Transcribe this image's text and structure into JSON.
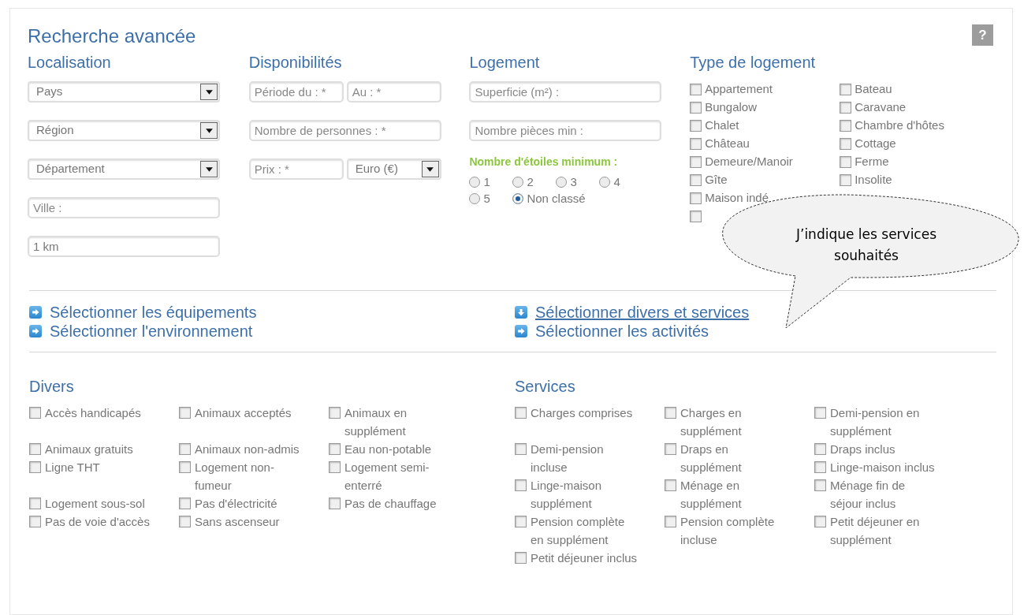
{
  "title": "Recherche avancée",
  "help": "?",
  "localisation": {
    "heading": "Localisation",
    "fields": [
      {
        "kind": "select",
        "value": "Pays"
      },
      {
        "kind": "select",
        "value": "Région"
      },
      {
        "kind": "select",
        "value": "Département"
      },
      {
        "kind": "input",
        "placeholder": "Ville :"
      },
      {
        "kind": "input",
        "value": "1 km"
      }
    ]
  },
  "disponibilites": {
    "heading": "Disponibilités",
    "rows": [
      [
        {
          "kind": "input",
          "placeholder": "Période du : *"
        },
        {
          "kind": "input",
          "placeholder": "Au : *"
        }
      ],
      [
        {
          "kind": "input",
          "placeholder": "Nombre de personnes : *"
        }
      ],
      [
        {
          "kind": "input",
          "placeholder": "Prix : *"
        },
        {
          "kind": "select",
          "value": "Euro (€)"
        }
      ]
    ]
  },
  "logement": {
    "heading": "Logement",
    "fields": [
      {
        "kind": "input",
        "placeholder": "Superficie (m²) :"
      },
      {
        "kind": "input",
        "placeholder": "Nombre pièces min :"
      }
    ],
    "stars_label": "Nombre d'étoiles minimum :",
    "stars_options": [
      {
        "label": "1",
        "selected": false
      },
      {
        "label": "2",
        "selected": false
      },
      {
        "label": "3",
        "selected": false
      },
      {
        "label": "4",
        "selected": false
      },
      {
        "label": "5",
        "selected": false
      },
      {
        "label": "Non classé",
        "selected": true
      }
    ]
  },
  "type_logement": {
    "heading": "Type de logement",
    "columns": [
      [
        {
          "label": "Appartement",
          "checked": false
        },
        {
          "label": "Bungalow",
          "checked": false
        },
        {
          "label": "Chalet",
          "checked": false
        },
        {
          "label": "Château",
          "checked": false
        },
        {
          "label": "Demeure/Manoir",
          "checked": false
        },
        {
          "label": "Gîte",
          "checked": false
        },
        {
          "label": "Maison indé",
          "checked": false
        },
        {
          "checked": false
        }
      ],
      [
        {
          "label": "Bateau",
          "checked": false
        },
        {
          "label": "Caravane",
          "checked": false
        },
        {
          "label": "Chambre d'hôtes",
          "checked": false
        },
        {
          "label": "Cottage",
          "checked": false
        },
        {
          "label": "Ferme",
          "checked": false
        },
        {
          "label": "Insolite",
          "checked": false
        }
      ]
    ]
  },
  "callout": "J’indique  les services souhaités",
  "links": [
    [
      {
        "label": "Sélectionner les équipements",
        "expanded": false
      },
      {
        "label": "Sélectionner l'environnement",
        "expanded": false
      }
    ],
    [
      {
        "label": "Sélectionner divers et services",
        "expanded": true
      },
      {
        "label": "Sélectionner les activités",
        "expanded": false
      }
    ]
  ],
  "divers": {
    "heading": "Divers",
    "items": [
      {
        "label": "Accès handicapés",
        "checked": false
      },
      {
        "label": "Animaux acceptés",
        "checked": false
      },
      {
        "label": "Animaux en supplément",
        "checked": false
      },
      {
        "label": "Animaux gratuits",
        "checked": false
      },
      {
        "label": "Animaux non-admis",
        "checked": false
      },
      {
        "label": "Eau non-potable",
        "checked": false
      },
      {
        "label": "Ligne THT",
        "checked": false
      },
      {
        "label": "Logement non-fumeur",
        "checked": false
      },
      {
        "label": "Logement semi-enterré",
        "checked": false
      },
      {
        "label": "Logement sous-sol",
        "checked": false
      },
      {
        "label": "Pas d'électricité",
        "checked": false
      },
      {
        "label": "Pas de chauffage",
        "checked": false
      },
      {
        "label": "Pas de voie d'accès",
        "checked": false
      },
      {
        "label": "Sans ascenseur",
        "checked": false
      }
    ]
  },
  "services": {
    "heading": "Services",
    "items": [
      {
        "label": "Charges comprises",
        "checked": false
      },
      {
        "label": "Charges en supplément",
        "checked": false
      },
      {
        "label": "Demi-pension en supplément",
        "checked": false
      },
      {
        "label": "Demi-pension incluse",
        "checked": false
      },
      {
        "label": "Draps en supplément",
        "checked": false
      },
      {
        "label": "Draps inclus",
        "checked": false
      },
      {
        "label": "Linge-maison inclus",
        "checked": false
      },
      {
        "label": "Linge-maison supplément",
        "checked": false
      },
      {
        "label": "Ménage en supplément",
        "checked": false
      },
      {
        "label": "Ménage fin de séjour inclus",
        "checked": false
      },
      {
        "label": "Pension complète en supplément",
        "checked": false
      },
      {
        "label": "Pension complète incluse",
        "checked": false
      },
      {
        "label": "Petit déjeuner en supplément",
        "checked": false
      },
      {
        "label": "Petit déjeuner inclus",
        "checked": false
      }
    ]
  }
}
